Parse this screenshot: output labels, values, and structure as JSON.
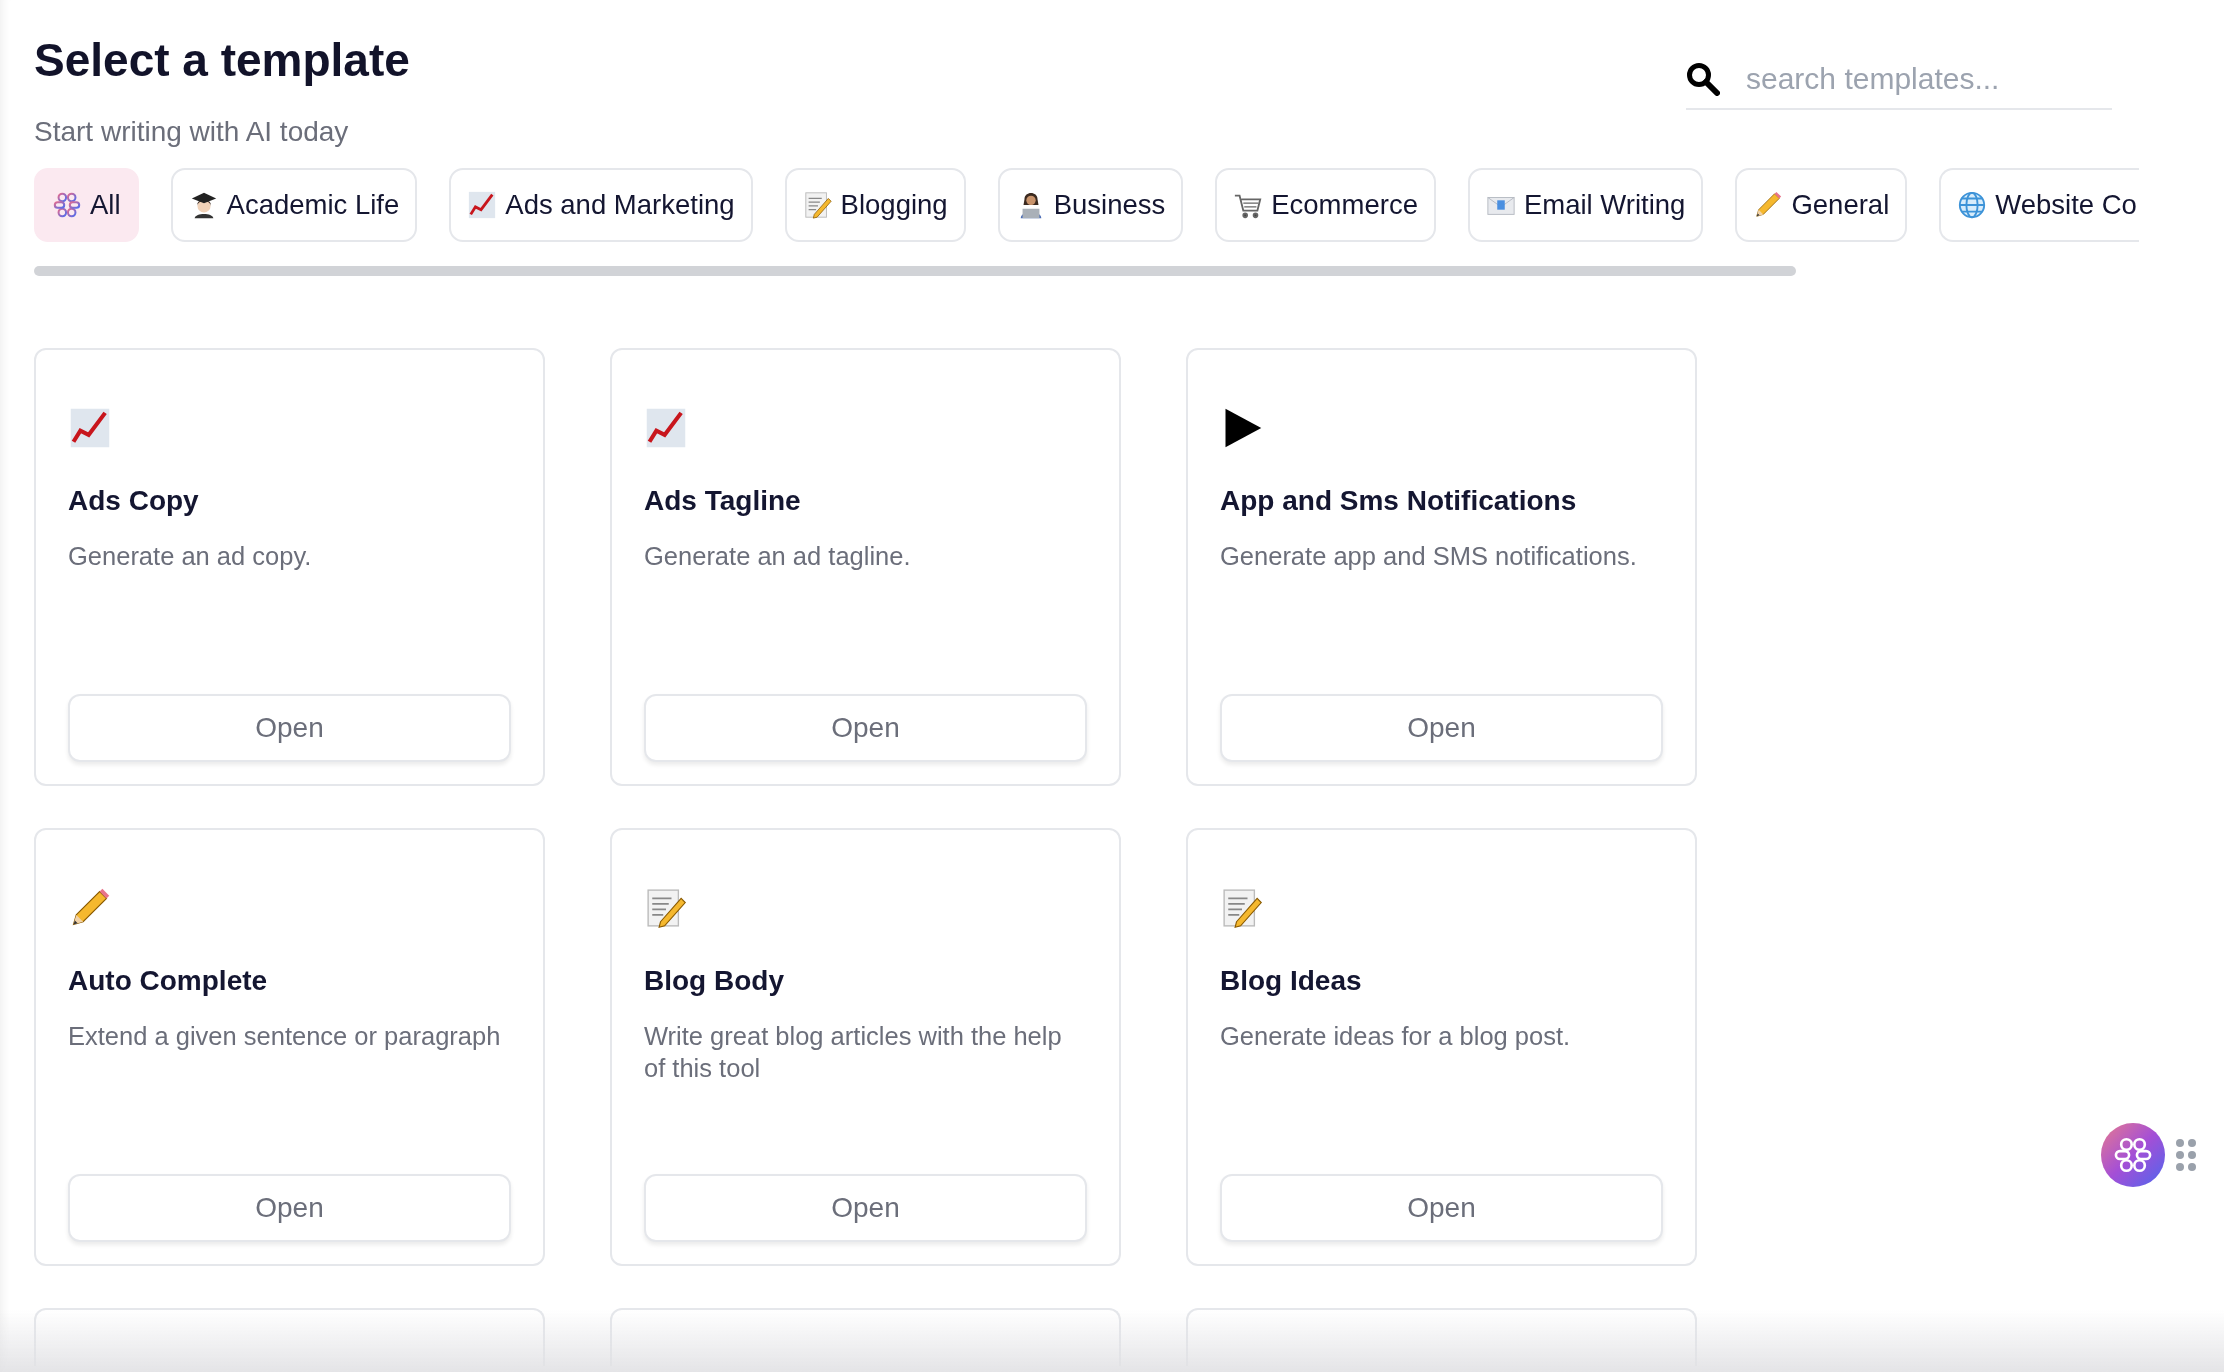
{
  "header": {
    "title": "Select a template",
    "subtitle": "Start writing with AI today"
  },
  "search": {
    "placeholder": "search templates..."
  },
  "categories": [
    {
      "label": "All",
      "kind": "brain",
      "selected": true
    },
    {
      "label": "Academic Life",
      "kind": "graduate",
      "selected": false
    },
    {
      "label": "Ads and Marketing",
      "kind": "chart",
      "selected": false
    },
    {
      "label": "Blogging",
      "kind": "memo",
      "selected": false
    },
    {
      "label": "Business",
      "kind": "person",
      "selected": false
    },
    {
      "label": "Ecommerce",
      "kind": "cart",
      "selected": false
    },
    {
      "label": "Email Writing",
      "kind": "envelope",
      "selected": false
    },
    {
      "label": "General",
      "kind": "pencil",
      "selected": false
    },
    {
      "label": "Website Co",
      "kind": "globe",
      "selected": false
    }
  ],
  "templates": [
    {
      "kind": "chart",
      "title": "Ads Copy",
      "description": "Generate an ad copy.",
      "button": "Open"
    },
    {
      "kind": "chart",
      "title": "Ads Tagline",
      "description": "Generate an ad tagline.",
      "button": "Open"
    },
    {
      "kind": "play",
      "title": "App and Sms Notifications",
      "description": "Generate app and SMS notifications.",
      "button": "Open"
    },
    {
      "kind": "pencil",
      "title": "Auto Complete",
      "description": "Extend a given sentence or paragraph",
      "button": "Open"
    },
    {
      "kind": "memo",
      "title": "Blog Body",
      "description": "Write great blog articles with the help of this tool",
      "button": "Open"
    },
    {
      "kind": "memo",
      "title": "Blog Ideas",
      "description": "Generate ideas for a blog post.",
      "button": "Open"
    },
    {
      "kind": "cutoff"
    },
    {
      "kind": "cutoff"
    },
    {
      "kind": "cutoff"
    }
  ]
}
